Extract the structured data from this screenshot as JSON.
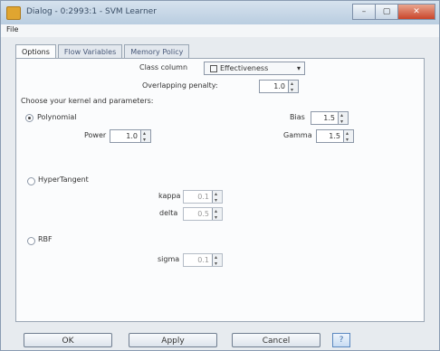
{
  "window": {
    "title": "Dialog - 0:2993:1 - SVM Learner",
    "min": "–",
    "max": "▢",
    "close": "✕"
  },
  "menu": {
    "file": "File"
  },
  "tabs": [
    {
      "label": "Options"
    },
    {
      "label": "Flow Variables"
    },
    {
      "label": "Memory Policy"
    }
  ],
  "options": {
    "class_column_label": "Class column",
    "class_column_value": "Effectiveness",
    "overlap_label": "Overlapping penalty:",
    "overlap_value": "1.0",
    "kernel_heading": "Choose your kernel and parameters:",
    "polynomial": {
      "label": "Polynomial",
      "selected": true,
      "bias_label": "Bias",
      "bias_value": "1.5",
      "power_label": "Power",
      "power_value": "1.0",
      "gamma_label": "Gamma",
      "gamma_value": "1.5"
    },
    "hypertangent": {
      "label": "HyperTangent",
      "selected": false,
      "kappa_label": "kappa",
      "kappa_value": "0.1",
      "delta_label": "delta",
      "delta_value": "0.5"
    },
    "rbf": {
      "label": "RBF",
      "selected": false,
      "sigma_label": "sigma",
      "sigma_value": "0.1"
    }
  },
  "buttons": {
    "ok": "OK",
    "apply": "Apply",
    "cancel": "Cancel",
    "help": "?"
  }
}
